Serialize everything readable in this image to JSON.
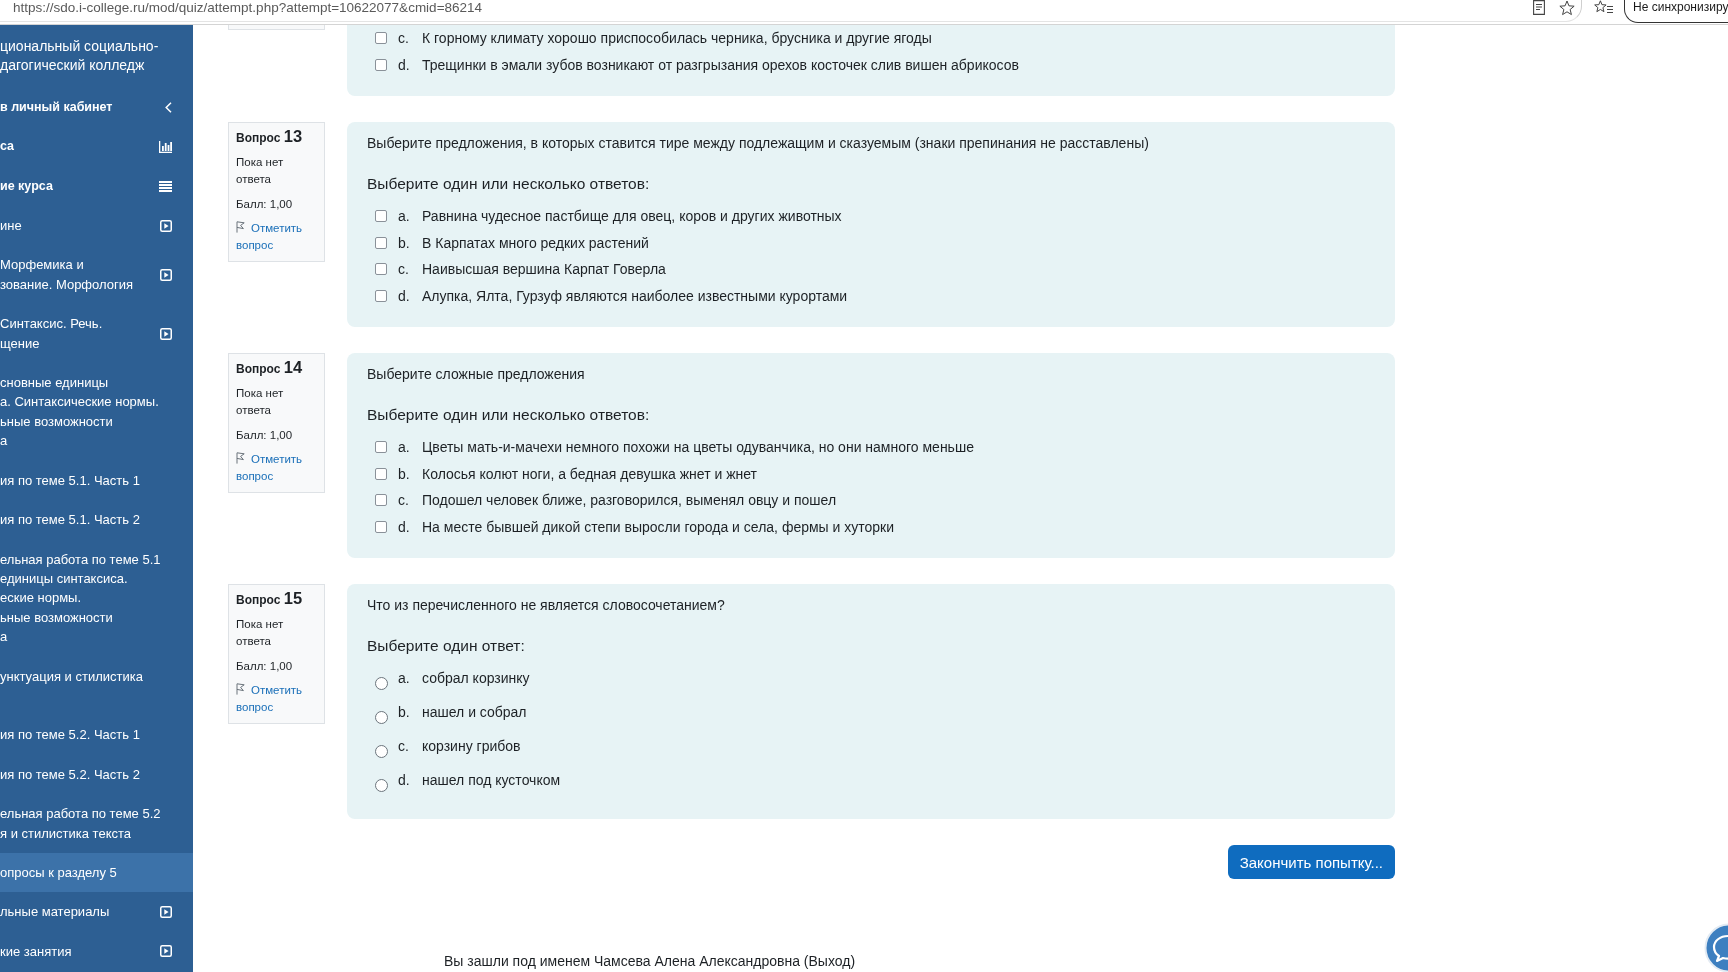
{
  "browser": {
    "url": "https://sdo.i-college.ru/mod/quiz/attempt.php?attempt=10622077&cmid=86214",
    "sync_button": "Не синхронизиру"
  },
  "sidebar": {
    "title_lines": [
      "циональный социально-",
      "дагогический колледж"
    ],
    "items": [
      {
        "kind": "back",
        "lines": [
          "в личный кабинет"
        ],
        "selected": false
      },
      {
        "kind": "stats",
        "lines": [
          "са"
        ],
        "selected": false
      },
      {
        "kind": "contents",
        "lines": [
          "ие курса"
        ],
        "selected": false
      },
      {
        "kind": "section",
        "lines": [
          "ине"
        ],
        "selected": false
      },
      {
        "kind": "section",
        "lines": [
          "Морфемика и",
          "зование. Морфология"
        ],
        "selected": false
      },
      {
        "kind": "section",
        "lines": [
          "Синтаксис. Речь.",
          "щение"
        ],
        "selected": false
      },
      {
        "kind": "activity",
        "lines": [
          "сновные единицы",
          "а. Синтаксические нормы.",
          "ьные возможности",
          "а"
        ],
        "selected": false
      },
      {
        "kind": "activity",
        "lines": [
          "ия по теме 5.1. Часть 1"
        ],
        "selected": false
      },
      {
        "kind": "activity",
        "lines": [
          "ия по теме 5.1. Часть 2"
        ],
        "selected": false
      },
      {
        "kind": "activity",
        "lines": [
          "ельная работа по теме 5.1",
          "единицы синтаксиса.",
          "еские нормы.",
          "ьные возможности",
          "а"
        ],
        "selected": false
      },
      {
        "kind": "activity",
        "lines": [
          "унктуация и стилистика"
        ],
        "selected": false
      },
      {
        "kind": "activity",
        "lines": [
          "ия по теме 5.2. Часть 1"
        ],
        "selected": false
      },
      {
        "kind": "activity",
        "lines": [
          "ия по теме 5.2. Часть 2"
        ],
        "selected": false
      },
      {
        "kind": "activity",
        "lines": [
          "ельная работа по теме 5.2",
          "я и стилистика текста"
        ],
        "selected": false
      },
      {
        "kind": "activity",
        "lines": [
          "опросы к разделу 5"
        ],
        "selected": true
      },
      {
        "kind": "section",
        "lines": [
          "льные материалы"
        ],
        "selected": false
      },
      {
        "kind": "section",
        "lines": [
          "кие занятия"
        ],
        "selected": false
      }
    ]
  },
  "questions": [
    {
      "kind": "checkbox",
      "options": [
        {
          "letter": "c.",
          "text": "К горному климату хорошо приспособилась черника, брусника и другие ягоды",
          "checked": false
        },
        {
          "letter": "d.",
          "text": "Трещинки в эмали зубов возникают от разгрызания орехов косточек слив вишен абрикосов",
          "checked": false
        }
      ]
    },
    {
      "info": {
        "label": "Вопрос",
        "number": "13",
        "status": "Пока нет ответа",
        "grade": "Балл: 1,00",
        "flag": "Отметить вопрос"
      },
      "text": "Выберите предложения, в которых ставится тире между подлежащим и сказуемым (знаки препинания не расставлены)",
      "prompt": "Выберите один или несколько ответов:",
      "kind": "checkbox",
      "options": [
        {
          "letter": "a.",
          "text": "Равнина чудесное пастбище для овец, коров и других животных",
          "checked": false
        },
        {
          "letter": "b.",
          "text": "В Карпатах много редких растений",
          "checked": false
        },
        {
          "letter": "c.",
          "text": "Наивысшая вершина Карпат Говерла",
          "checked": false
        },
        {
          "letter": "d.",
          "text": "Алупка, Ялта, Гурзуф являются наиболее известными курортами",
          "checked": false
        }
      ]
    },
    {
      "info": {
        "label": "Вопрос",
        "number": "14",
        "status": "Пока нет ответа",
        "grade": "Балл: 1,00",
        "flag": "Отметить вопрос"
      },
      "text": "Выберите сложные предложения",
      "prompt": "Выберите один или несколько ответов:",
      "kind": "checkbox",
      "options": [
        {
          "letter": "a.",
          "text": "Цветы мать-и-мачехи немного похожи на цветы одуванчика, но они намного меньше",
          "checked": false
        },
        {
          "letter": "b.",
          "text": "Колосья колют ноги, а бедная девушка жнет и жнет",
          "checked": false
        },
        {
          "letter": "c.",
          "text": "Подошел человек ближе, разговорился, выменял овцу и пошел",
          "checked": false
        },
        {
          "letter": "d.",
          "text": "На месте бывшей дикой степи выросли города и села, фермы и хуторки",
          "checked": false
        }
      ]
    },
    {
      "info": {
        "label": "Вопрос",
        "number": "15",
        "status": "Пока нет ответа",
        "grade": "Балл: 1,00",
        "flag": "Отметить вопрос"
      },
      "text": "Что из перечисленного не является словосочетанием?",
      "prompt": "Выберите один ответ:",
      "kind": "radio",
      "options": [
        {
          "letter": "a.",
          "text": "собрал корзинку",
          "selected": false
        },
        {
          "letter": "b.",
          "text": "нашел и собрал",
          "selected": false
        },
        {
          "letter": "c.",
          "text": "корзину грибов",
          "selected": false
        },
        {
          "letter": "d.",
          "text": "нашел под кусточком",
          "selected": false
        }
      ]
    }
  ],
  "finish_button": "Закончить попытку...",
  "footer": "Вы зашли под именем Чамсева Алена Александровна (Выход)"
}
